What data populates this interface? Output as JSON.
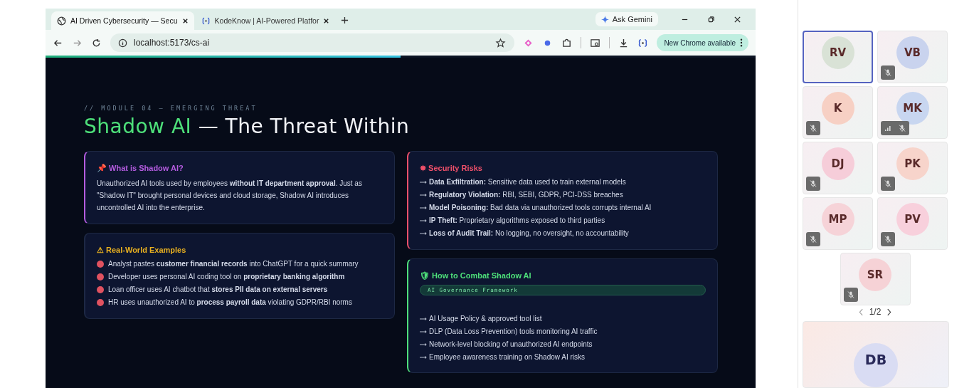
{
  "browser": {
    "tabs": [
      {
        "title": "AI Driven Cybersecurity — Secu",
        "selected": true
      },
      {
        "title": "KodeKnow | AI-Powered Platfor",
        "selected": false
      }
    ],
    "gemini_button": "Ask Gemini",
    "url": "localhost:5173/cs-ai",
    "update_button": "New Chrome available"
  },
  "page": {
    "reading_progress": {
      "level": 0.5
    },
    "eyebrow": "// MODULE 04 — EMERGING THREAT",
    "title_highlight": "Shadow AI",
    "title_rest": "— The Threat Within",
    "columns": [
      [
        {
          "kind": "paragraph",
          "icon": "📌",
          "heading": "What is Shadow AI?",
          "color": "#b55ce0",
          "text": "Unauthorized AI tools used by employees **without IT department approval**. Just as \"Shadow IT\" brought personal devices and cloud storage, Shadow AI introduces uncontrolled AI into the enterprise."
        },
        {
          "kind": "bullets",
          "icon": "⚠",
          "heading": "Real-World Examples",
          "color": "#e8b020",
          "items": [
            "Analyst pastes **customer financial records** into ChatGPT for a quick summary",
            "Developer uses personal AI coding tool on **proprietary banking algorithm**",
            "Loan officer uses AI chatbot that **stores PII data on external servers**",
            "HR uses unauthorized AI to **process payroll data** violating GDPR/RBI norms"
          ]
        }
      ],
      [
        {
          "kind": "arrows",
          "icon": "✸",
          "heading": "Security Risks",
          "color": "#f0506a",
          "items": [
            "**Data Exfiltration:** Sensitive data used to train external models",
            "**Regulatory Violation:** RBI, SEBI, GDPR, PCI-DSS breaches",
            "**Model Poisoning:** Bad data via unauthorized tools corrupts internal AI",
            "**IP Theft:** Proprietary algorithms exposed to third parties",
            "**Loss of Audit Trail:** No logging, no oversight, no accountability"
          ]
        },
        {
          "kind": "arrows",
          "icon": "🛡",
          "heading": "How to Combat Shadow AI",
          "color": "#4ee07a",
          "tag": "AI Governance Framework",
          "items": [
            "AI Usage Policy & approved tool list",
            "DLP (Data Loss Prevention) tools monitoring AI traffic",
            "Network-level blocking of unauthorized AI endpoints",
            "Employee awareness training on Shadow AI risks"
          ]
        }
      ]
    ]
  },
  "meeting": {
    "participants": [
      {
        "initials": "RV",
        "color": "#d9e2d6",
        "selected": true,
        "muted": false,
        "weak_network": false
      },
      {
        "initials": "VB",
        "color": "#c9d3ee",
        "selected": false,
        "muted": true,
        "weak_network": false
      },
      {
        "initials": "K",
        "color": "#f7d0c4",
        "selected": false,
        "muted": true,
        "weak_network": false
      },
      {
        "initials": "MK",
        "color": "#c8d6f0",
        "selected": false,
        "muted": true,
        "weak_network": true
      },
      {
        "initials": "DJ",
        "color": "#f6cdd9",
        "selected": false,
        "muted": true,
        "weak_network": false
      },
      {
        "initials": "PK",
        "color": "#f7d4cb",
        "selected": false,
        "muted": true,
        "weak_network": false
      },
      {
        "initials": "MP",
        "color": "#f6d3d8",
        "selected": false,
        "muted": true,
        "weak_network": false
      },
      {
        "initials": "PV",
        "color": "#f8d0dc",
        "selected": false,
        "muted": true,
        "weak_network": false
      },
      {
        "initials": "SR",
        "color": "#f6d2d6",
        "selected": false,
        "muted": true,
        "weak_network": false
      }
    ],
    "pager": "1/2",
    "spotlight": {
      "initials": "DB",
      "color": "#d9dcf3"
    }
  }
}
